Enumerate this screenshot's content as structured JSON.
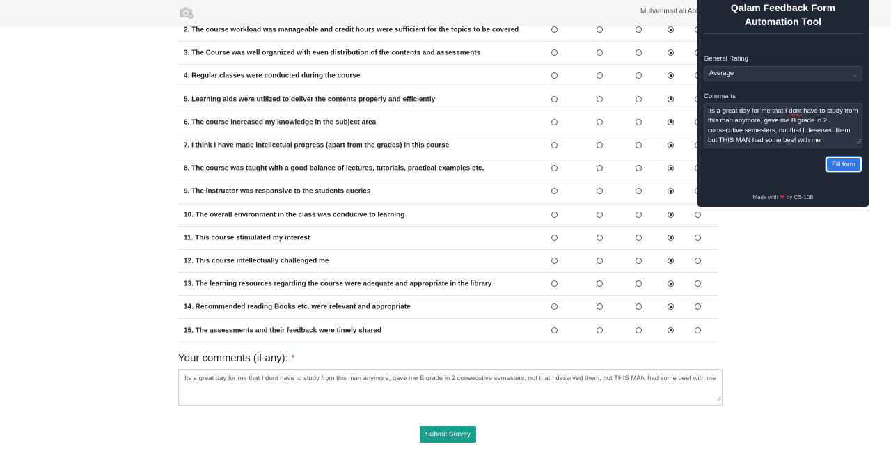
{
  "header": {
    "username": "Muhammad ali Abbas",
    "camera_icon": "camera-icon"
  },
  "survey": {
    "questions": [
      {
        "label": "2. The course workload was manageable and credit hours were sufficient for the topics to be covered",
        "selected": 4
      },
      {
        "label": "3. The Course was well organized with even distribution of the contents and assessments",
        "selected": 4
      },
      {
        "label": "4. Regular classes were conducted during the course",
        "selected": 4
      },
      {
        "label": "5. Learning aids were utilized to deliver the contents properly and efficiently",
        "selected": 4
      },
      {
        "label": "6. The course increased my knowledge in the subject area",
        "selected": 4
      },
      {
        "label": "7. I think I have made intellectual progress (apart from the grades) in this course",
        "selected": 4
      },
      {
        "label": "8. The course was taught with a good balance of lectures, tutorials, practical examples etc.",
        "selected": 4
      },
      {
        "label": "9. The instructor was responsive to the students queries",
        "selected": 4
      },
      {
        "label": "10. The overall environment in the class was conducive to learning",
        "selected": 4
      },
      {
        "label": "11. This course stimulated my interest",
        "selected": 4
      },
      {
        "label": "12. This course intellectually challenged me",
        "selected": 4
      },
      {
        "label": "13. The learning resources regarding the course were adequate and appropriate in the library",
        "selected": 4
      },
      {
        "label": "14. Recommended reading Books etc. were relevant and appropriate",
        "selected": 4
      },
      {
        "label": "15. The assessments and their feedback were timely shared",
        "selected": 4
      }
    ],
    "comments_heading": "Your comments (if any):",
    "required_mark": "*",
    "comments_value": "Its a great day for me that I dont have to study from this man anymore, gave me B grade in 2 consecutive semesters, not that I deserved them, but THIS MAN had some beef with me",
    "submit_label": "Submit Survey"
  },
  "panel": {
    "title": "Qalam Feedback Form Automation Tool",
    "rating_label": "General Rating",
    "rating_value": "Average",
    "comments_label": "Comments",
    "comments_before": "Its a great day for me that I ",
    "comments_misspelled": "dont",
    "comments_after": " have to study from this man anymore, gave me B grade in 2 consecutive semesters, not that I deserved them, but THIS MAN had some beef with me",
    "fill_label": "Fill form",
    "footer_made": "Made with",
    "footer_by": "by CS-10B"
  },
  "colors": {
    "panel_bg": "#212835",
    "fill_button": "#2f7ae5",
    "submit_button": "#17a08f",
    "required": "#d9534f",
    "heart": "#e0243a"
  }
}
